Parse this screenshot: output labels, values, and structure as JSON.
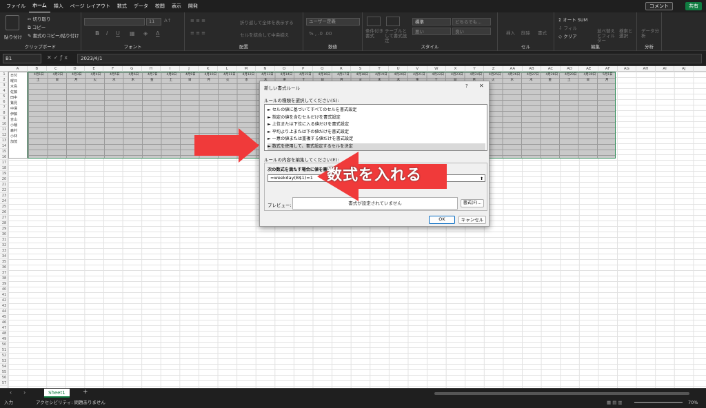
{
  "colors": {
    "accent": "#107c41",
    "arrow": "#f03a3a",
    "ok_border": "#0067c0"
  },
  "menubar": {
    "items": [
      "ファイル",
      "ホーム",
      "挿入",
      "ページ レイアウト",
      "数式",
      "データ",
      "校閲",
      "表示",
      "開発"
    ],
    "active_index": 1,
    "comment_label": "コメント",
    "share_label": "共有"
  },
  "ribbon": {
    "clipboard": {
      "paste": "貼り付け",
      "cut": "切り取り",
      "copy": "コピー",
      "format_painter": "書式のコピー/貼り付け",
      "label": "クリップボード"
    },
    "font": {
      "font_name": "",
      "font_size": "11",
      "label": "フォント"
    },
    "alignment": {
      "wrap": "折り返して全体を表示する",
      "merge": "セルを結合して中央揃え",
      "label": "配置"
    },
    "number": {
      "format": "ユーザー定義",
      "label": "数値"
    },
    "styles": {
      "cond_format": "条件付き書式",
      "table_format": "テーブルとして書式設定",
      "normal": "標準",
      "neutral": "どちらでも...",
      "bad": "悪い",
      "good": "良い",
      "label": "スタイル"
    },
    "cells": {
      "insert": "挿入",
      "delete": "削除",
      "format": "書式",
      "label": "セル"
    },
    "editing": {
      "autosum": "オート SUM",
      "fill": "フィル",
      "clear": "クリア",
      "sort": "並べ替えとフィルター",
      "find": "検索と選択",
      "label": "編集"
    },
    "analysis": {
      "analyze": "データ分析",
      "label": "分析"
    }
  },
  "formula_bar": {
    "name_box": "B1",
    "formula": "2023/4/1"
  },
  "grid": {
    "columns": [
      "A",
      "B",
      "C",
      "D",
      "E",
      "F",
      "G",
      "H",
      "I",
      "J",
      "K",
      "L",
      "M",
      "N",
      "O",
      "P",
      "Q",
      "R",
      "S",
      "T",
      "U",
      "V",
      "W",
      "X",
      "Y",
      "Z",
      "AA",
      "AB",
      "AC",
      "AD",
      "AE",
      "AF",
      "AG",
      "AH",
      "AI",
      "AJ"
    ],
    "rows": [
      "1",
      "2",
      "3",
      "4",
      "5",
      "6",
      "7",
      "8",
      "9",
      "10",
      "11",
      "12",
      "13",
      "14",
      "15",
      "16",
      "17",
      "18",
      "19",
      "20",
      "21",
      "22",
      "23",
      "24",
      "25",
      "26",
      "27",
      "28",
      "29",
      "30",
      "31",
      "32",
      "33",
      "34",
      "35",
      "36",
      "37",
      "38",
      "39",
      "40",
      "41",
      "42",
      "43",
      "44",
      "45",
      "46",
      "47",
      "48",
      "49",
      "50",
      "51",
      "52",
      "53",
      "54",
      "55",
      "56",
      "57"
    ],
    "a_column": [
      "日付",
      "曜日",
      "木島",
      "佐藤",
      "田中",
      "鷲見",
      "中澤",
      "伊藤",
      "吉山",
      "小幡",
      "森村",
      "小林",
      "加茂"
    ],
    "dates": [
      "4月1日",
      "4月2日",
      "4月3日",
      "4月4日",
      "4月5日",
      "4月6日",
      "4月7日",
      "4月8日",
      "4月9日",
      "4月10日",
      "4月11日",
      "4月12日",
      "4月13日",
      "4月14日",
      "4月15日",
      "4月16日",
      "4月17日",
      "4月18日",
      "4月19日",
      "4月20日",
      "4月21日",
      "4月22日",
      "4月23日",
      "4月24日",
      "4月25日",
      "4月26日",
      "4月27日",
      "4月28日",
      "4月29日",
      "4月30日",
      "5月1日"
    ],
    "weekdays": [
      "土",
      "日",
      "月",
      "火",
      "水",
      "木",
      "金",
      "土",
      "日",
      "月",
      "火",
      "水",
      "木",
      "金",
      "土",
      "日",
      "月",
      "火",
      "水",
      "木",
      "金",
      "土",
      "日",
      "月",
      "火",
      "水",
      "木",
      "金",
      "土",
      "日",
      "月"
    ]
  },
  "sheetbar": {
    "tab": "Sheet1",
    "add": "+"
  },
  "statusbar": {
    "mode": "入力",
    "accessibility": "アクセシビリティ: 問題ありません",
    "zoom": "70%"
  },
  "dialog": {
    "title": "新しい書式ルール",
    "help": "?",
    "close": "✕",
    "rule_type_label": "ルールの種類を選択してください(S):",
    "rule_types": [
      "► セルの値に基づいてすべてのセルを書式設定",
      "► 指定の値を含むセルだけを書式設定",
      "► 上位または下位に入る値だけを書式設定",
      "► 平均より上または下の値だけを書式設定",
      "► 一意の値または重複する値だけを書式設定",
      "► 数式を使用して、書式設定するセルを決定"
    ],
    "selected_index": 5,
    "edit_label": "ルールの内容を編集してください(E):",
    "condition_label": "次の数式を満たす場合に値を書式設定(O):",
    "formula_value": "=weekday(B$1)=1",
    "preview_label": "プレビュー:",
    "preview_text": "書式が設定されていません",
    "format_button": "書式(F)...",
    "ok": "OK",
    "cancel": "キャンセル"
  },
  "annotation": {
    "text": "数式を入れる"
  }
}
